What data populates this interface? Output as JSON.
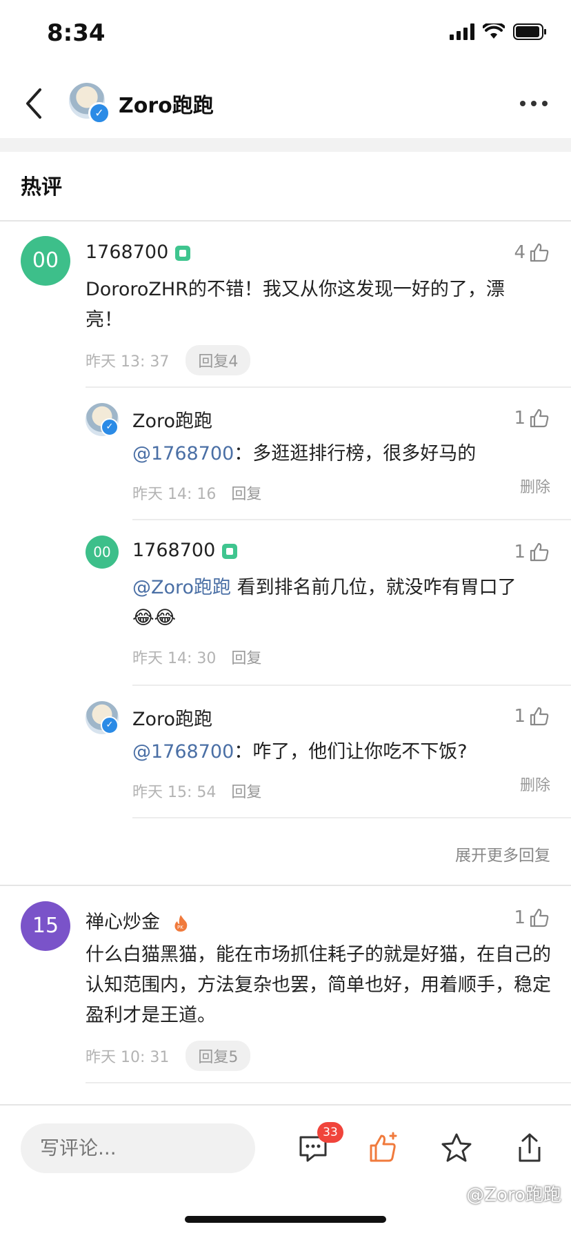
{
  "status_bar": {
    "time": "8:34"
  },
  "nav": {
    "title": "Zoro跑跑"
  },
  "section": {
    "title": "热评"
  },
  "comments": [
    {
      "avatar_text": "00",
      "user": "1768700",
      "likes": "4",
      "text": "DororoZHR的不错！我又从你这发现一好的了，漂亮！",
      "time": "昨天 13: 37",
      "reply_label": "回复4",
      "replies": [
        {
          "user": "Zoro跑跑",
          "likes": "1",
          "mention": "@1768700",
          "text": "：多逛逛排行榜，很多好马的",
          "time": "昨天 14: 16",
          "reply_label": "回复",
          "delete_label": "删除"
        },
        {
          "avatar_text": "00",
          "user": "1768700",
          "likes": "1",
          "mention": "@Zoro跑跑",
          "text": " 看到排名前几位，就没咋有胃口了",
          "emoji": "😂😂",
          "time": "昨天 14: 30",
          "reply_label": "回复"
        },
        {
          "user": "Zoro跑跑",
          "likes": "1",
          "mention": "@1768700",
          "text": "：咋了，他们让你吃不下饭?",
          "time": "昨天 15: 54",
          "reply_label": "回复",
          "delete_label": "删除"
        }
      ],
      "expand_label": "展开更多回复"
    },
    {
      "avatar_text": "15",
      "user": "禅心炒金",
      "likes": "1",
      "text": "什么白猫黑猫，能在市场抓住耗子的就是好猫，在自己的认知范围内，方法复杂也罢，简单也好，用着顺手，稳定盈利才是王道。",
      "time": "昨天 10: 31",
      "reply_label": "回复5"
    }
  ],
  "bottom_bar": {
    "input_placeholder": "写评论...",
    "comment_count": "33"
  },
  "watermark": "@Zoro跑跑",
  "colors": {
    "green_avatar": "#3dbf8a",
    "purple_avatar": "#7a53c9",
    "mention": "#4a6fa5",
    "like_orange": "#f07a3c",
    "badge_red": "#f0443b"
  }
}
